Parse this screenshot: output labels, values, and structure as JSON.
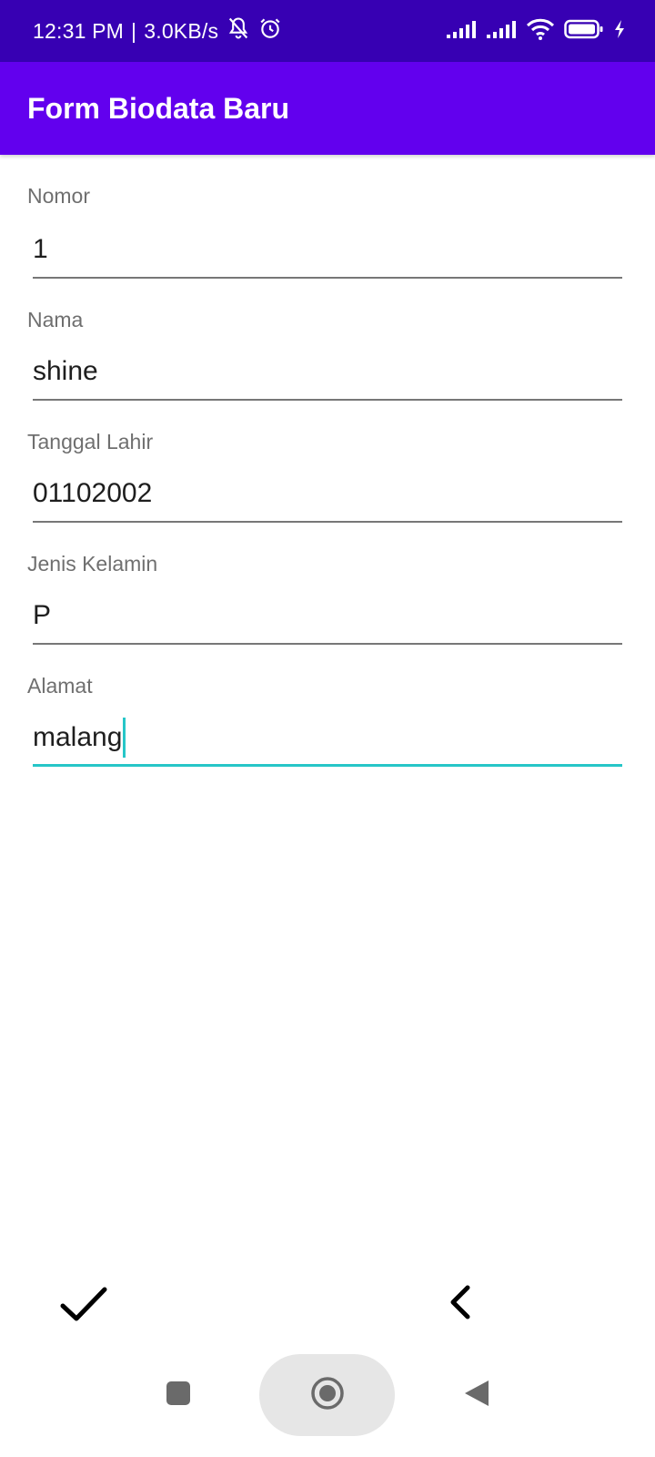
{
  "status_bar": {
    "time": "12:31 PM",
    "separator": "|",
    "network_speed": "3.0KB/s",
    "icons": [
      "bell-muted-icon",
      "alarm-icon",
      "signal-icon",
      "signal-icon",
      "wifi-icon",
      "battery-icon",
      "charging-icon"
    ]
  },
  "app_bar": {
    "title": "Form Biodata Baru",
    "color": "#6200ee"
  },
  "form": {
    "fields": [
      {
        "label": "Nomor",
        "value": "1"
      },
      {
        "label": "Nama",
        "value": "shine"
      },
      {
        "label": "Tanggal Lahir",
        "value": "01102002"
      },
      {
        "label": "Jenis Kelamin",
        "value": "P"
      },
      {
        "label": "Alamat",
        "value": "malang"
      }
    ],
    "focused_field": "Alamat",
    "accent_color": "#26c6c8"
  },
  "actions": {
    "confirm_icon": "check-icon",
    "back_icon": "chevron-left-icon"
  },
  "nav_bar": {
    "icons": [
      "recents-icon",
      "home-icon",
      "back-icon"
    ]
  }
}
